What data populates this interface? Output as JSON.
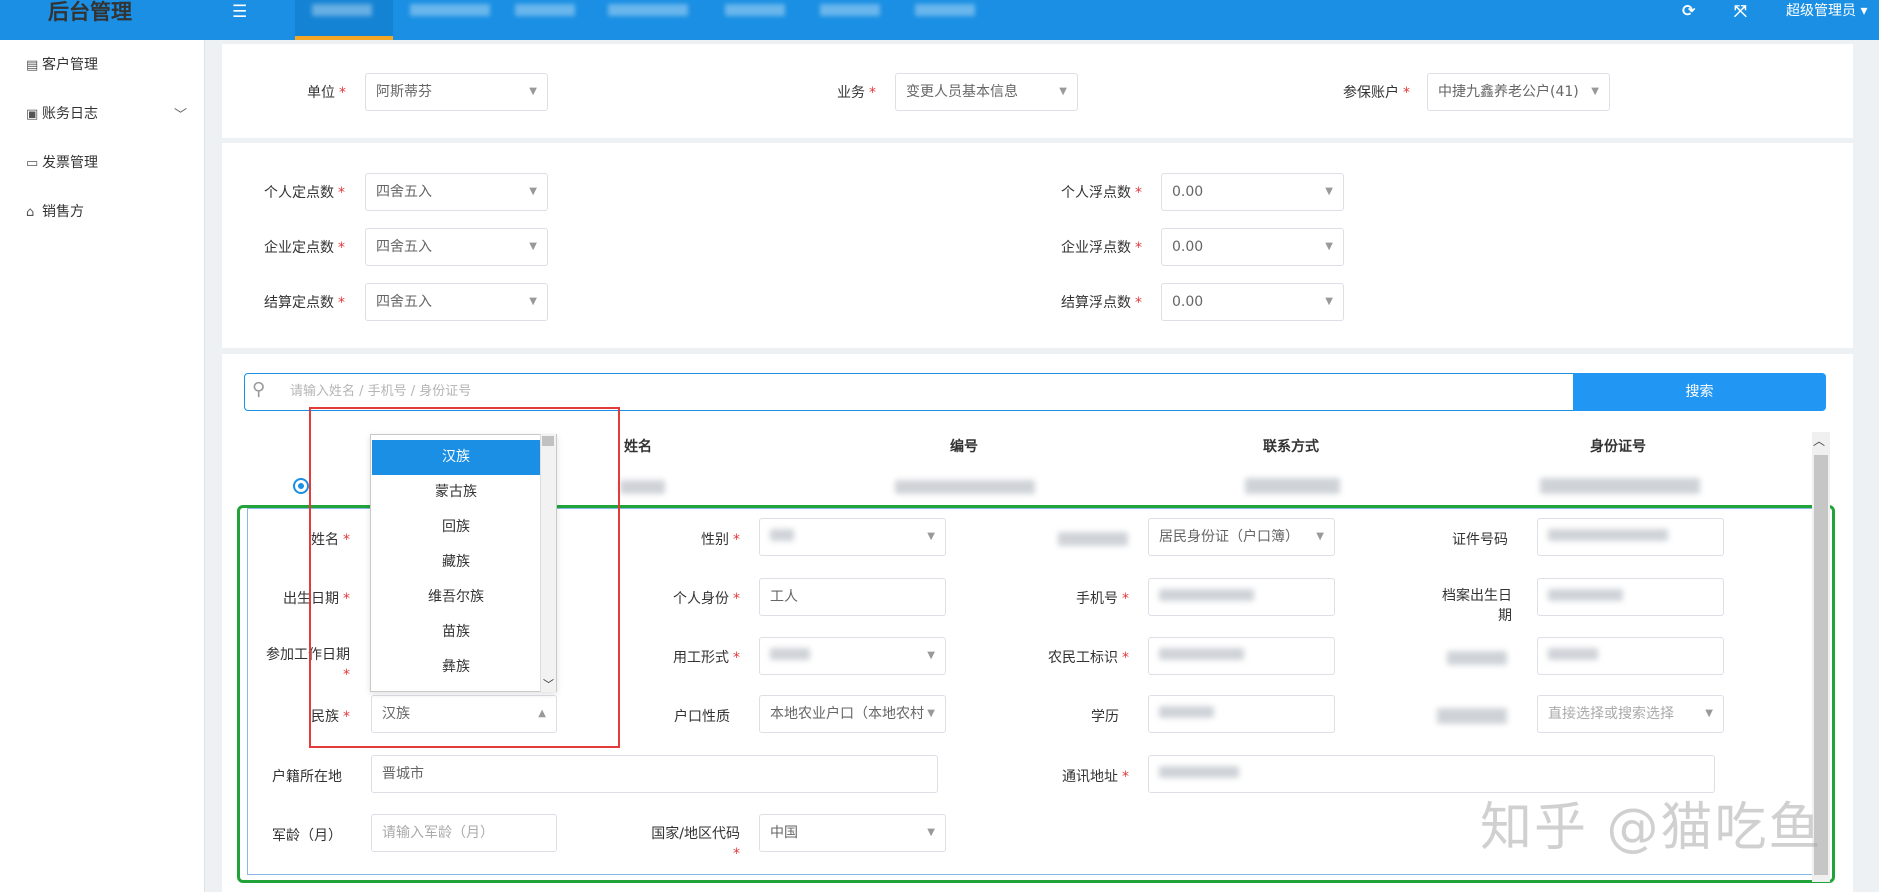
{
  "app": {
    "title": "后台管理",
    "user": "超级管理员"
  },
  "topbar": {
    "menu_icon": "menu-icon",
    "refresh_icon": "refresh-icon",
    "fullscreen_icon": "fullscreen-icon"
  },
  "sidebar": {
    "items": [
      {
        "label": "客户管理",
        "icon": "building-icon"
      },
      {
        "label": "账务日志",
        "icon": "printer-icon"
      },
      {
        "label": "发票管理",
        "icon": "ticket-icon"
      },
      {
        "label": "销售方",
        "icon": "tag-icon"
      }
    ]
  },
  "filters": {
    "unit": {
      "label": "单位",
      "value": "阿斯蒂芬"
    },
    "business": {
      "label": "业务",
      "value": "变更人员基本信息"
    },
    "account": {
      "label": "参保账户",
      "value": "中捷九鑫养老公户(41)"
    }
  },
  "rounding": {
    "personal_fixed": {
      "label": "个人定点数",
      "value": "四舍五入"
    },
    "personal_float": {
      "label": "个人浮点数",
      "value": "0.00"
    },
    "company_fixed": {
      "label": "企业定点数",
      "value": "四舍五入"
    },
    "company_float": {
      "label": "企业浮点数",
      "value": "0.00"
    },
    "settle_fixed": {
      "label": "结算定点数",
      "value": "四舍五入"
    },
    "settle_float": {
      "label": "结算浮点数",
      "value": "0.00"
    }
  },
  "search": {
    "placeholder": "请输入姓名 / 手机号 / 身份证号",
    "button": "搜索"
  },
  "table": {
    "headers": [
      "姓名",
      "编号",
      "联系方式",
      "身份证号"
    ]
  },
  "form": {
    "name": {
      "label": "姓名"
    },
    "gender": {
      "label": "性别"
    },
    "id_type": {
      "value": "居民身份证（户口簿）"
    },
    "id_number": {
      "label": "证件号码"
    },
    "birth_date": {
      "label": "出生日期"
    },
    "identity": {
      "label": "个人身份",
      "value": "工人"
    },
    "phone": {
      "label": "手机号"
    },
    "archive_birth": {
      "label": "档案出生日期"
    },
    "work_date": {
      "label": "参加工作日期"
    },
    "employment": {
      "label": "用工形式"
    },
    "migrant": {
      "label": "农民工标识"
    },
    "ethnicity": {
      "label": "民族",
      "value": "汉族"
    },
    "household_type": {
      "label": "户口性质",
      "value": "本地农业户口（本地农村"
    },
    "education": {
      "label": "学历"
    },
    "select_or_search": {
      "placeholder": "直接选择或搜索选择"
    },
    "household_location": {
      "label": "户籍所在地",
      "value": "晋城市"
    },
    "address": {
      "label": "通讯地址"
    },
    "military": {
      "label": "军龄（月）",
      "placeholder": "请输入军龄（月）"
    },
    "country": {
      "label": "国家/地区代码",
      "value": "中国"
    }
  },
  "ethnicity_options": [
    "汉族",
    "蒙古族",
    "回族",
    "藏族",
    "维吾尔族",
    "苗族",
    "彝族"
  ],
  "colors": {
    "primary": "#1a8fe3",
    "required": "#e4393c",
    "annotation_red": "#e33a3a",
    "annotation_green": "#22a33a"
  },
  "watermark": "知乎 @猫吃鱼"
}
